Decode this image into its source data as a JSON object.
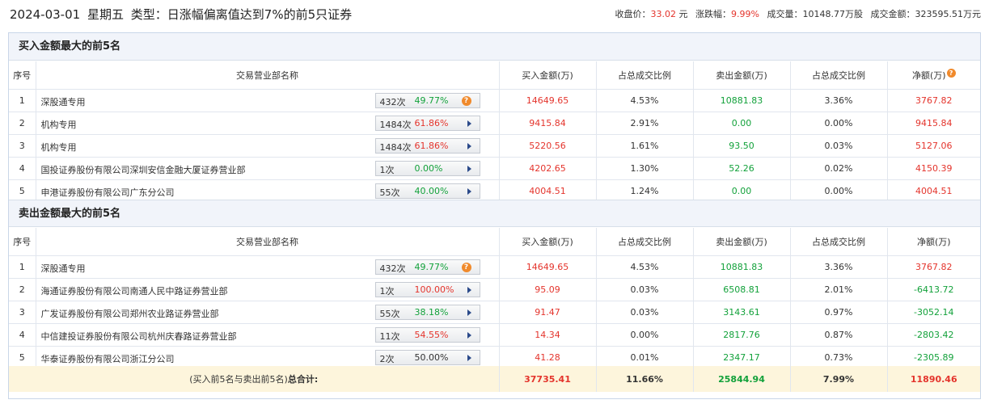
{
  "header": {
    "date": "2024-03-01",
    "weekday": "星期五",
    "type_label": "类型：",
    "type_value": "日涨幅偏离值达到7%的前5只证券",
    "close_label": "收盘价：",
    "close_value": "33.02",
    "close_unit": "元",
    "change_label": "涨跌幅：",
    "change_value": "9.99%",
    "volume_label": "成交量：",
    "volume_value": "10148.77万股",
    "amount_label": "成交金额：",
    "amount_value": "323595.51万元"
  },
  "columns": {
    "seq": "序号",
    "name": "交易营业部名称",
    "buy": "买入金额(万)",
    "buy_ratio": "占总成交比例",
    "sell": "卖出金额(万)",
    "sell_ratio": "占总成交比例",
    "net": "净额(万)"
  },
  "buy_section": {
    "title": "买入金额最大的前5名",
    "rows": [
      {
        "seq": "1",
        "name": "深股通专用",
        "count": "432次",
        "pct": "49.77%",
        "pct_color": "green",
        "marker": "question",
        "buy": "14649.65",
        "buy_ratio": "4.53%",
        "sell": "10881.83",
        "sell_ratio": "3.36%",
        "net": "3767.82",
        "net_color": "red"
      },
      {
        "seq": "2",
        "name": "机构专用",
        "count": "1484次",
        "pct": "61.86%",
        "pct_color": "red",
        "marker": "arrow",
        "buy": "9415.84",
        "buy_ratio": "2.91%",
        "sell": "0.00",
        "sell_ratio": "0.00%",
        "net": "9415.84",
        "net_color": "red"
      },
      {
        "seq": "3",
        "name": "机构专用",
        "count": "1484次",
        "pct": "61.86%",
        "pct_color": "red",
        "marker": "arrow",
        "buy": "5220.56",
        "buy_ratio": "1.61%",
        "sell": "93.50",
        "sell_ratio": "0.03%",
        "net": "5127.06",
        "net_color": "red"
      },
      {
        "seq": "4",
        "name": "国投证券股份有限公司深圳安信金融大厦证券营业部",
        "count": "1次",
        "pct": "0.00%",
        "pct_color": "green",
        "marker": "arrow",
        "buy": "4202.65",
        "buy_ratio": "1.30%",
        "sell": "52.26",
        "sell_ratio": "0.02%",
        "net": "4150.39",
        "net_color": "red"
      },
      {
        "seq": "5",
        "name": "申港证券股份有限公司广东分公司",
        "count": "55次",
        "pct": "40.00%",
        "pct_color": "green",
        "marker": "arrow",
        "buy": "4004.51",
        "buy_ratio": "1.24%",
        "sell": "0.00",
        "sell_ratio": "0.00%",
        "net": "4004.51",
        "net_color": "red"
      }
    ]
  },
  "sell_section": {
    "title": "卖出金额最大的前5名",
    "rows": [
      {
        "seq": "1",
        "name": "深股通专用",
        "count": "432次",
        "pct": "49.77%",
        "pct_color": "green",
        "marker": "question",
        "buy": "14649.65",
        "buy_ratio": "4.53%",
        "sell": "10881.83",
        "sell_ratio": "3.36%",
        "net": "3767.82",
        "net_color": "red"
      },
      {
        "seq": "2",
        "name": "海通证券股份有限公司南通人民中路证券营业部",
        "count": "1次",
        "pct": "100.00%",
        "pct_color": "red",
        "marker": "arrow",
        "buy": "95.09",
        "buy_ratio": "0.03%",
        "sell": "6508.81",
        "sell_ratio": "2.01%",
        "net": "-6413.72",
        "net_color": "green"
      },
      {
        "seq": "3",
        "name": "广发证券股份有限公司郑州农业路证券营业部",
        "count": "55次",
        "pct": "38.18%",
        "pct_color": "green",
        "marker": "arrow",
        "buy": "91.47",
        "buy_ratio": "0.03%",
        "sell": "3143.61",
        "sell_ratio": "0.97%",
        "net": "-3052.14",
        "net_color": "green"
      },
      {
        "seq": "4",
        "name": "中信建投证券股份有限公司杭州庆春路证券营业部",
        "count": "11次",
        "pct": "54.55%",
        "pct_color": "red",
        "marker": "arrow",
        "buy": "14.34",
        "buy_ratio": "0.00%",
        "sell": "2817.76",
        "sell_ratio": "0.87%",
        "net": "-2803.42",
        "net_color": "green"
      },
      {
        "seq": "5",
        "name": "华泰证券股份有限公司浙江分公司",
        "count": "2次",
        "pct": "50.00%",
        "pct_color": "neutral",
        "marker": "arrow",
        "buy": "41.28",
        "buy_ratio": "0.01%",
        "sell": "2347.17",
        "sell_ratio": "0.73%",
        "net": "-2305.89",
        "net_color": "green"
      }
    ]
  },
  "total": {
    "label_prefix": "(买入前5名与卖出前5名)",
    "label_bold": "总合计:",
    "buy": "37735.41",
    "buy_ratio": "11.66%",
    "sell": "25844.94",
    "sell_ratio": "7.99%",
    "net": "11890.46"
  },
  "colors": {
    "red": "#e4342c",
    "green": "#12a13a",
    "accent_orange": "#f08a2c",
    "header_bg": "#f1f4fa",
    "total_bg": "#fdf5dc"
  },
  "icons": {
    "question": "question-circle-icon",
    "arrow": "play-arrow-icon"
  }
}
